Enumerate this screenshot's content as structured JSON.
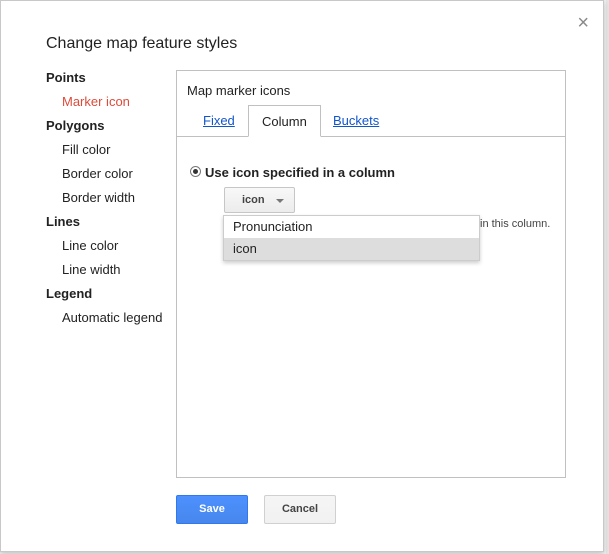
{
  "dialog": {
    "title": "Change map feature styles",
    "close_glyph": "×"
  },
  "sidebar": {
    "groups": [
      {
        "heading": "Points",
        "items": [
          "Marker icon"
        ]
      },
      {
        "heading": "Polygons",
        "items": [
          "Fill color",
          "Border color",
          "Border width"
        ]
      },
      {
        "heading": "Lines",
        "items": [
          "Line color",
          "Line width"
        ]
      },
      {
        "heading": "Legend",
        "items": [
          "Automatic legend"
        ]
      }
    ],
    "active_item": "Marker icon"
  },
  "panel": {
    "title": "Map marker icons",
    "tabs": [
      "Fixed",
      "Column",
      "Buckets"
    ],
    "active_tab": "Column",
    "option_label": "Use icon specified in a column",
    "select_value": "icon",
    "hint_suffix": "in this column.",
    "dropdown_options": [
      "Pronunciation",
      "icon"
    ],
    "dropdown_selected": "icon"
  },
  "footer": {
    "save_label": "Save",
    "cancel_label": "Cancel"
  },
  "colors": {
    "active_sidebar": "#dd4b39",
    "link": "#1155cc",
    "primary_button": "#4d90fe"
  }
}
